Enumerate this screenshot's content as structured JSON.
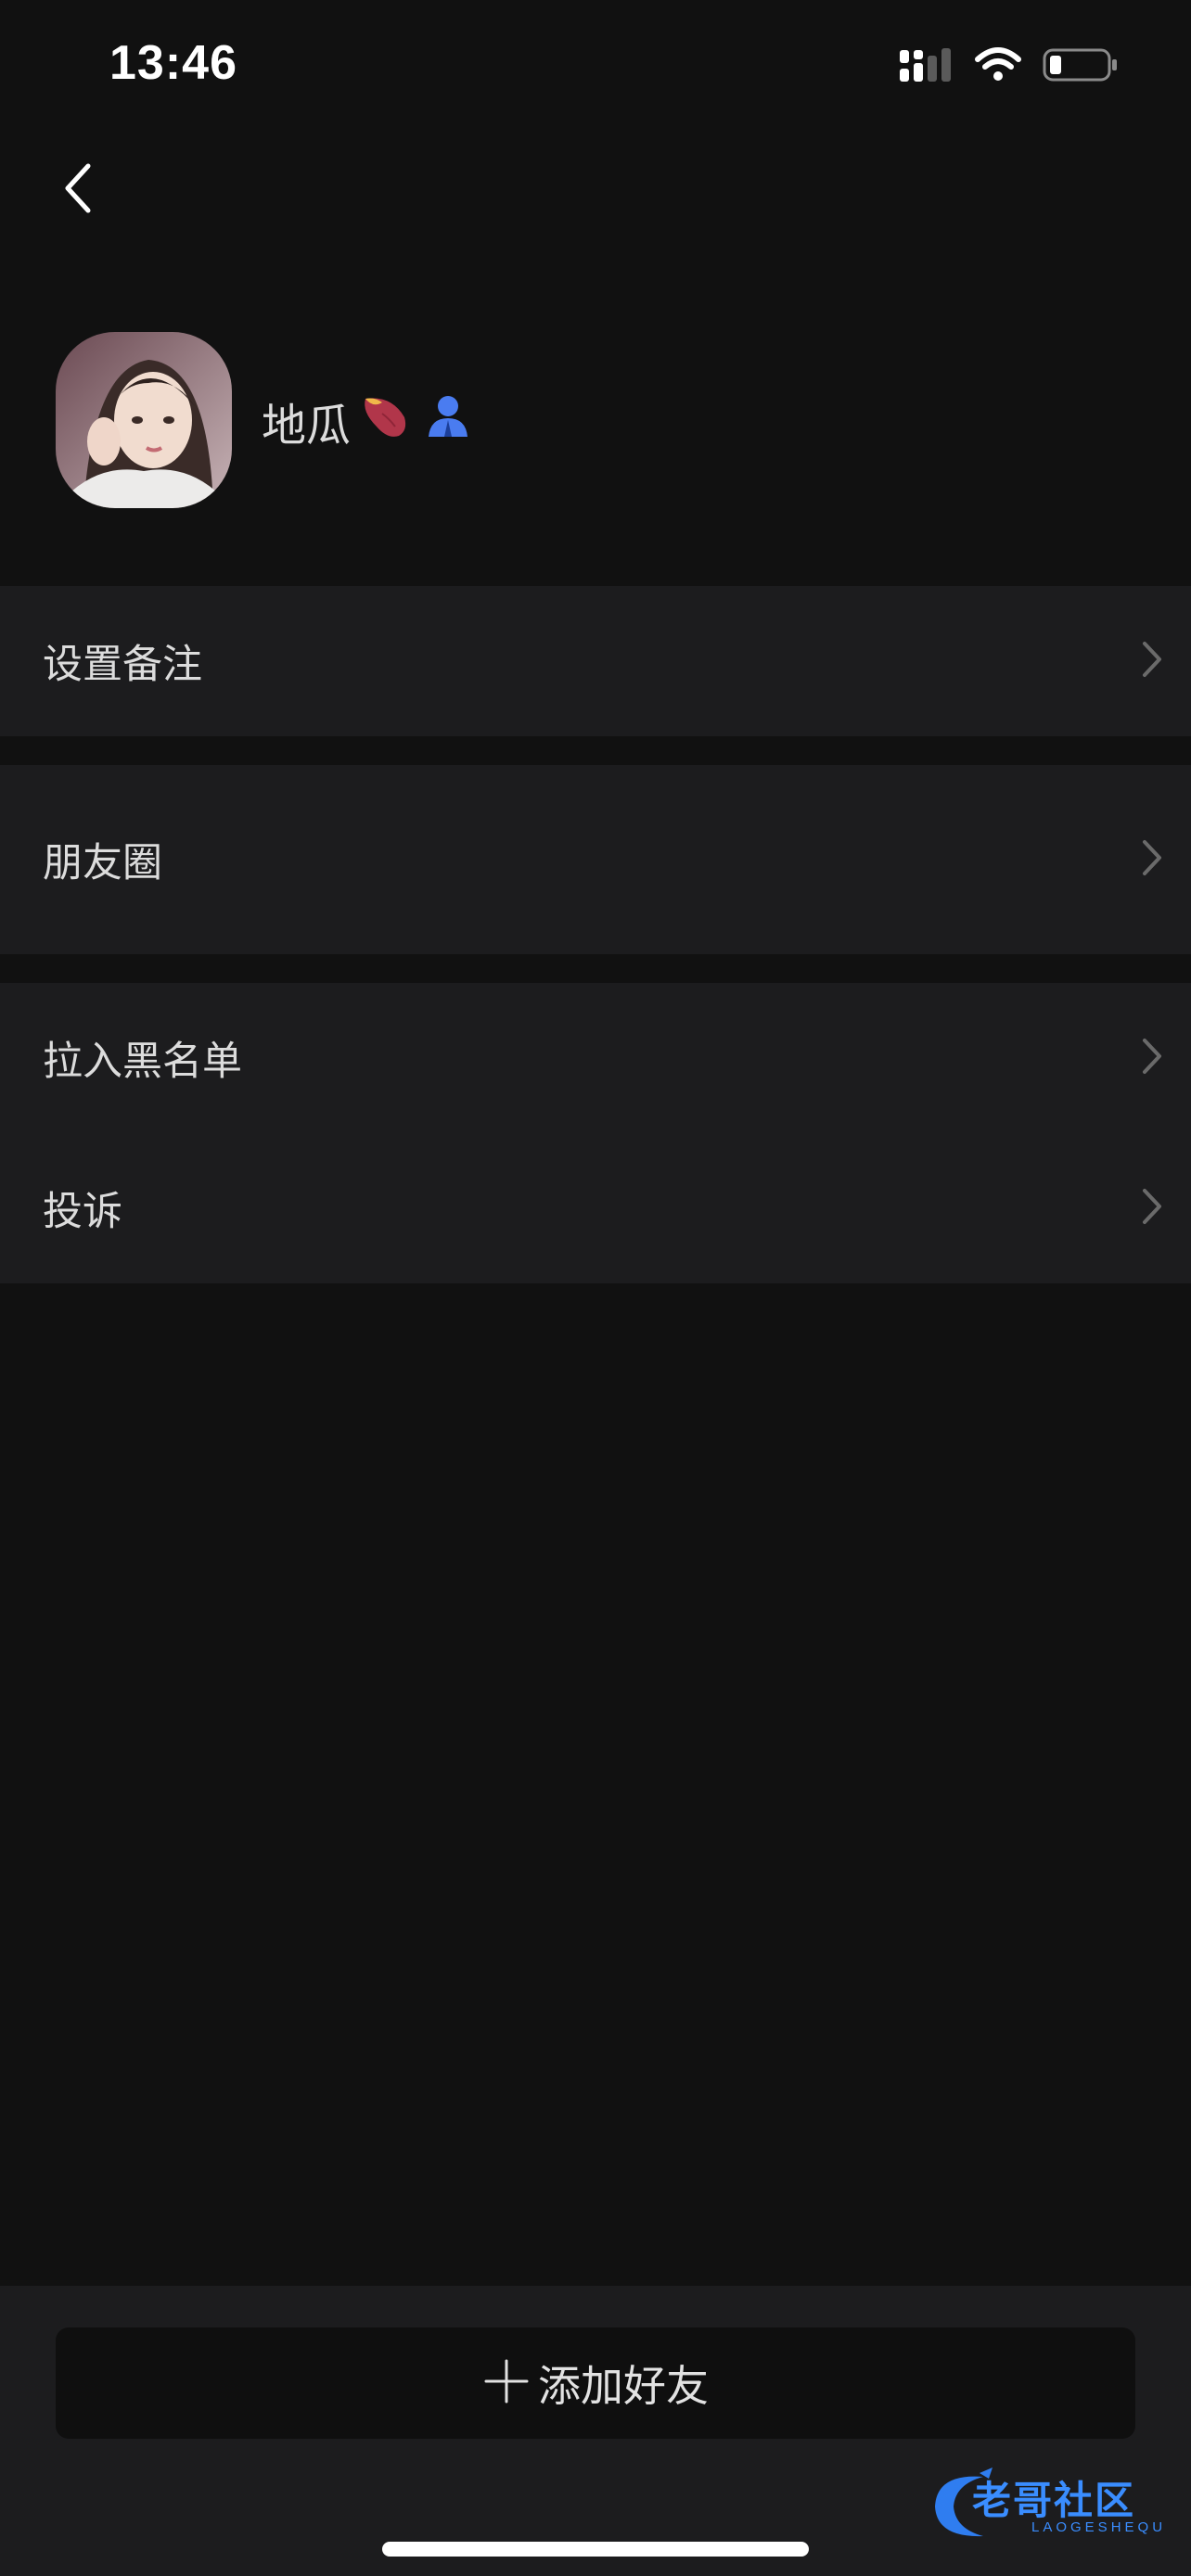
{
  "status_bar": {
    "time": "13:46"
  },
  "profile": {
    "name": "地瓜",
    "name_emoji": "sweet-potato-icon",
    "badge_icon": "person-badge-icon"
  },
  "menu": {
    "set_remark": "设置备注",
    "moments": "朋友圈",
    "blacklist": "拉入黑名单",
    "report": "投诉"
  },
  "bottom": {
    "add_friend_label": "添加好友"
  },
  "watermark": {
    "title": "老哥社区",
    "subtitle": "LAOGESHEQU"
  },
  "colors": {
    "background": "#111111",
    "row_background": "#1c1c1e",
    "badge_blue": "#4a7cf0",
    "watermark_blue": "#3a8dff"
  }
}
